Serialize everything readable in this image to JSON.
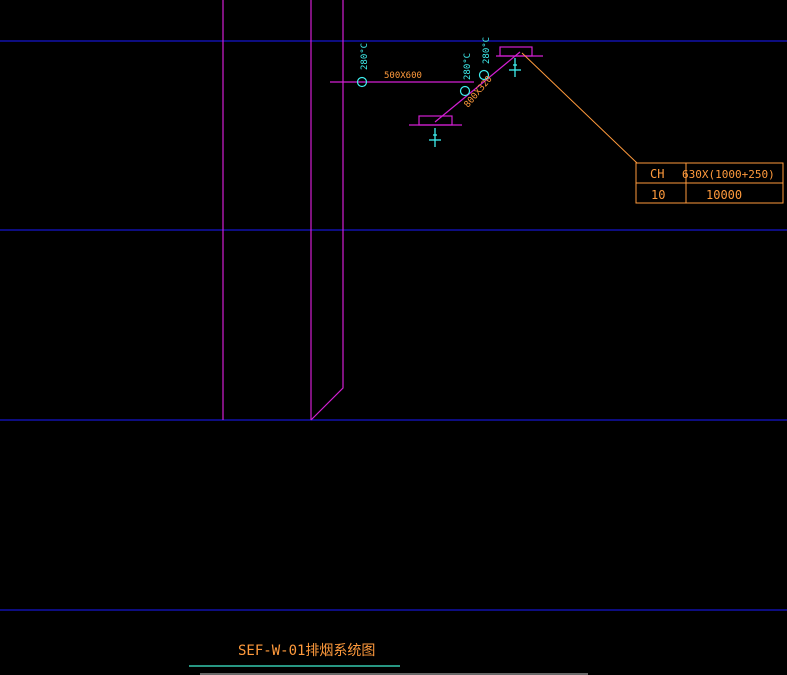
{
  "drawing": {
    "title": "SEF-W-01排烟系统图"
  },
  "duct_labels": {
    "main_duct_size": "500X600",
    "branch_duct_size": "800X320"
  },
  "damper_labels": {
    "damper_1_temp": "280°C",
    "damper_2_temp": "280°C",
    "damper_3_temp": "280°C"
  },
  "equipment_table": {
    "row1_col1": "CH",
    "row1_col2": "630X(1000+250)",
    "row2_col1": "10",
    "row2_col2": "10000"
  },
  "colors": {
    "background": "#000000",
    "grid_line": "#1a1aff",
    "shaft": "#d21fd2",
    "duct": "#d21fd2",
    "annotation": "#ff9a3c",
    "symbol": "#3ff0f0",
    "title_underline": "#3ff0d0"
  }
}
